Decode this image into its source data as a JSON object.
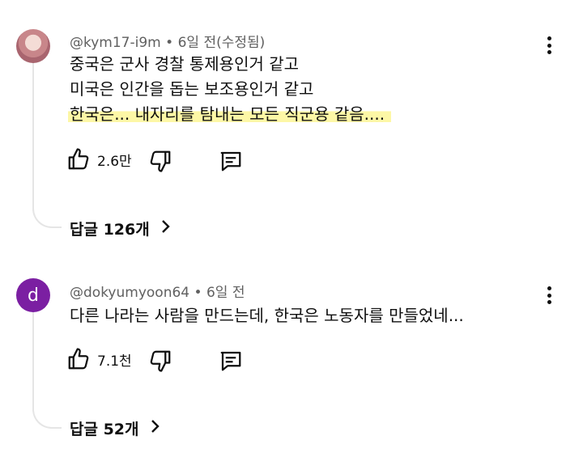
{
  "comments": [
    {
      "username": "@kym17-i9m",
      "separator": "•",
      "time": "6일 전(수정됨)",
      "avatar": "kym17-i9m-avatar-image",
      "lines": [
        "중국은 군사 경찰 통제용인거 같고",
        "미국은 인간을 돕는 보조용인거 같고",
        "한국은... 내자리를 탐내는 모든 직군용 같음...."
      ],
      "highlight_color": "#fdf7a6",
      "likes": "2.6만",
      "replies": "답글 126개"
    },
    {
      "username": "@dokyumyoon64",
      "separator": "•",
      "time": "6일 전",
      "avatar_letter": "d",
      "avatar_color": "#7b1fa2",
      "lines": [
        "다른 나라는 사람을 만드는데, 한국은 노동자를 만들었네..."
      ],
      "likes": "7.1천",
      "replies": "답글 52개"
    }
  ],
  "icons": {
    "like": "thumbs-up-icon",
    "dislike": "thumbs-down-icon",
    "reply": "comment-icon",
    "more": "more-vert-icon",
    "expand": "chevron-right-icon"
  }
}
